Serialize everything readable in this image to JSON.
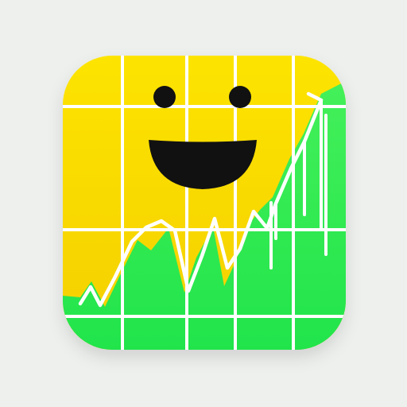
{
  "icon": {
    "name": "smiley-growth-chart-app-icon",
    "colors": {
      "background": "#eef0ee",
      "tile_yellow": "#f8d300",
      "tile_yellow_light": "#fde400",
      "chart_green": "#2ee84a",
      "chart_green_light": "#58f56c",
      "grid_white": "#ffffff",
      "face_black": "#111111"
    }
  }
}
